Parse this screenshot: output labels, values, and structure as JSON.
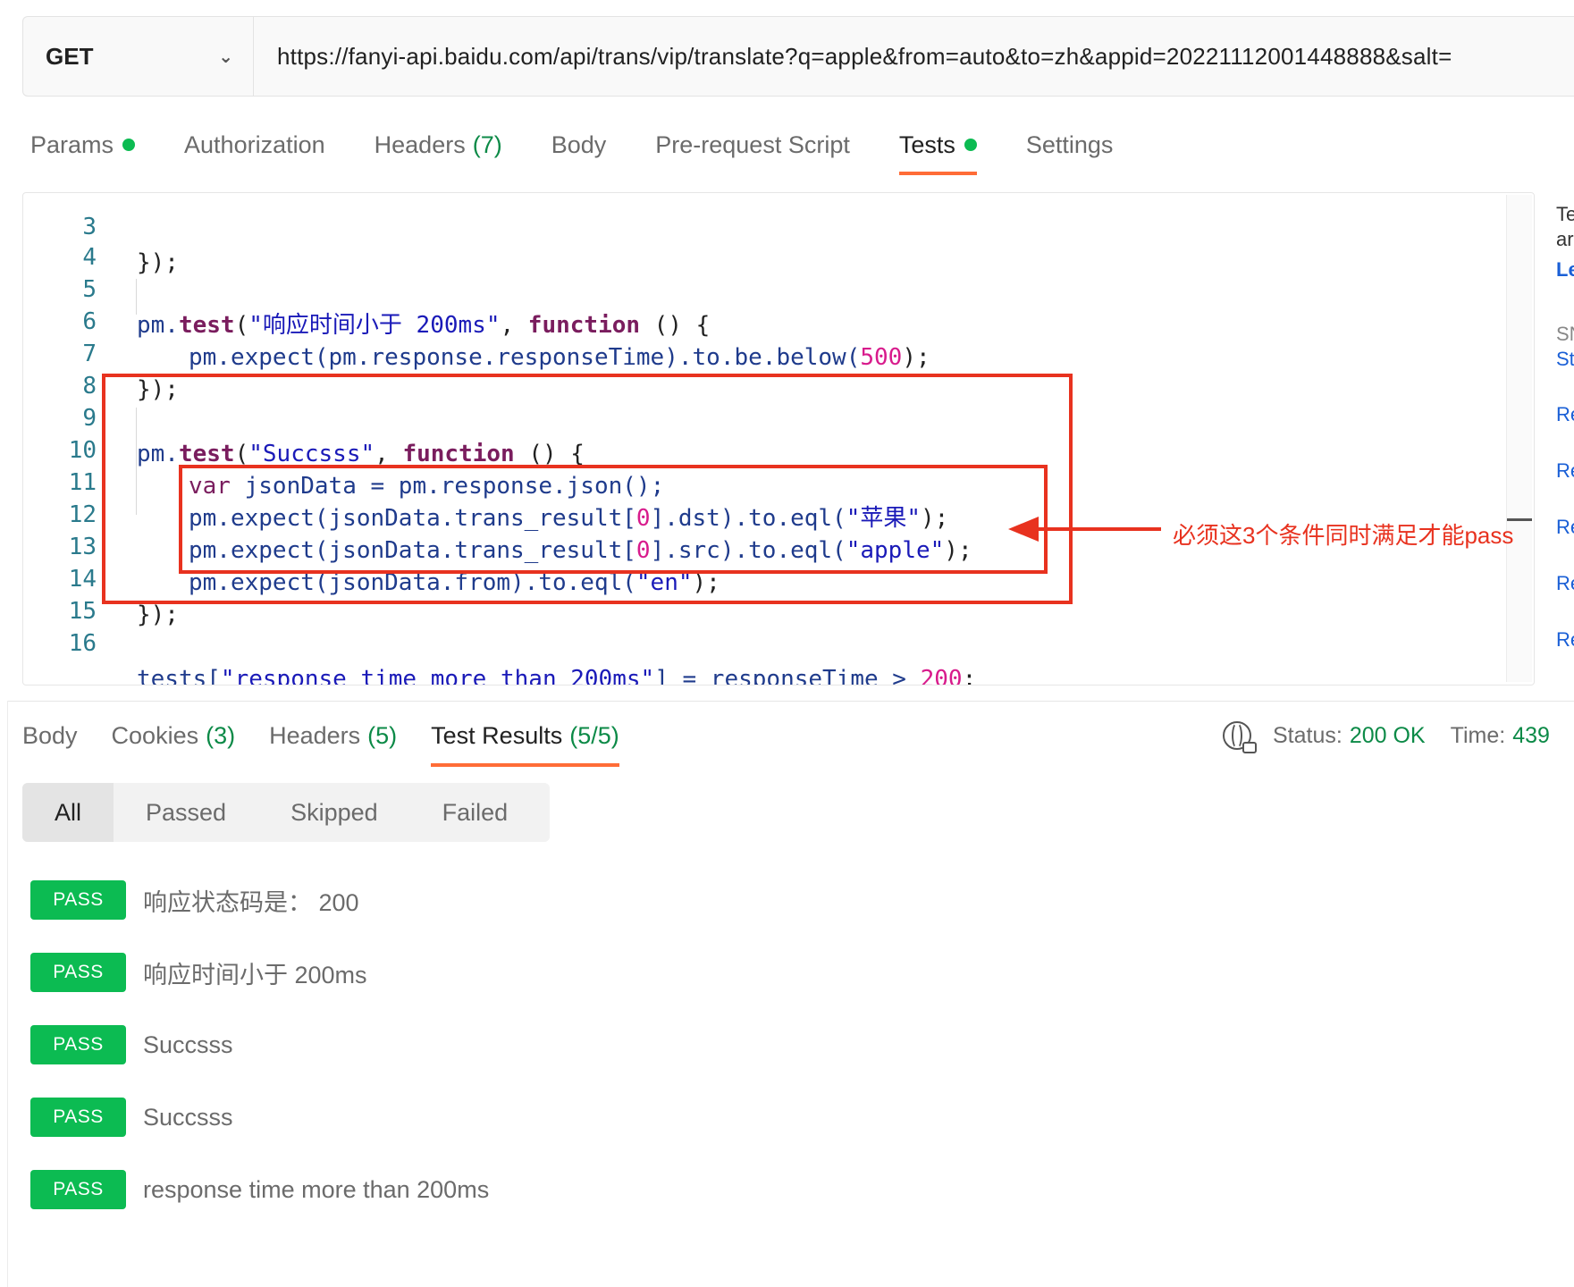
{
  "request": {
    "method": "GET",
    "url": "https://fanyi-api.baidu.com/api/trans/vip/translate?q=apple&from=auto&to=zh&appid=20221112001448888&salt="
  },
  "request_tabs": [
    {
      "label": "Params",
      "count": "",
      "dot": true
    },
    {
      "label": "Authorization",
      "count": "",
      "dot": false
    },
    {
      "label": "Headers",
      "count": "(7)",
      "dot": false
    },
    {
      "label": "Body",
      "count": "",
      "dot": false
    },
    {
      "label": "Pre-request Script",
      "count": "",
      "dot": false
    },
    {
      "label": "Tests",
      "count": "",
      "dot": true,
      "active": true
    },
    {
      "label": "Settings",
      "count": "",
      "dot": false
    }
  ],
  "editor": {
    "line_numbers": [
      "3",
      "4",
      "5",
      "6",
      "7",
      "8",
      "9",
      "10",
      "11",
      "12",
      "13",
      "14",
      "15",
      "16"
    ],
    "lines": {
      "l3": "});",
      "l5_pre": "pm.",
      "l5_test": "test",
      "l5_open": "(",
      "l5_str": "\"响应时间小于 200ms\"",
      "l5_comma": ", ",
      "l5_kw": "function",
      "l5_end": " () {",
      "l6_a": "pm.expect(pm.response.responseTime).to.be.below(",
      "l6_num": "500",
      "l6_end": ");",
      "l7": "});",
      "l9_pre": "pm.",
      "l9_test": "test",
      "l9_open": "(",
      "l9_str": "\"Succsss\"",
      "l9_comma": ", ",
      "l9_kw": "function",
      "l9_end": " () {",
      "l10_var": "var",
      "l10_rest": " jsonData = pm.response.json();",
      "l11_a": "pm.expect(jsonData.trans_result[",
      "l11_num": "0",
      "l11_b": "].dst).to.eql(",
      "l11_str": "\"苹果\"",
      "l11_end": ");",
      "l12_a": "pm.expect(jsonData.trans_result[",
      "l12_num": "0",
      "l12_b": "].src).to.eql(",
      "l12_str": "\"apple\"",
      "l12_end": ");",
      "l13_a": "pm.expect(jsonData.from).to.eql(",
      "l13_str": "\"en\"",
      "l13_end": ");",
      "l14": "});",
      "l16_a": "tests[",
      "l16_str": "\"response time more than 200ms\"",
      "l16_b": "] = responseTime > ",
      "l16_num": "200",
      "l16_end": ";"
    }
  },
  "annotation": "必须这3个条件同时满足才能pass",
  "side_panel": [
    "Te",
    "ar",
    "Le",
    "SN",
    "St",
    "Re",
    "Re",
    "Re",
    "Re",
    "Re"
  ],
  "response_tabs": [
    {
      "label": "Body",
      "count": ""
    },
    {
      "label": "Cookies",
      "count": "(3)"
    },
    {
      "label": "Headers",
      "count": "(5)"
    },
    {
      "label": "Test Results",
      "count": "(5/5)",
      "active": true
    }
  ],
  "status": {
    "label": "Status:",
    "value": "200 OK",
    "time_label": "Time:",
    "time_value": "439"
  },
  "filters": [
    "All",
    "Passed",
    "Skipped",
    "Failed"
  ],
  "results": [
    {
      "badge": "PASS",
      "name": "响应状态码是： 200"
    },
    {
      "badge": "PASS",
      "name": "响应时间小于 200ms"
    },
    {
      "badge": "PASS",
      "name": "Succsss"
    },
    {
      "badge": "PASS",
      "name": "Succsss"
    },
    {
      "badge": "PASS",
      "name": "response time more than 200ms"
    }
  ],
  "colors": {
    "accent": "#ff6c37",
    "pass": "#0cbb52",
    "annotation": "#e8321f",
    "count_green": "#0c8a47"
  }
}
